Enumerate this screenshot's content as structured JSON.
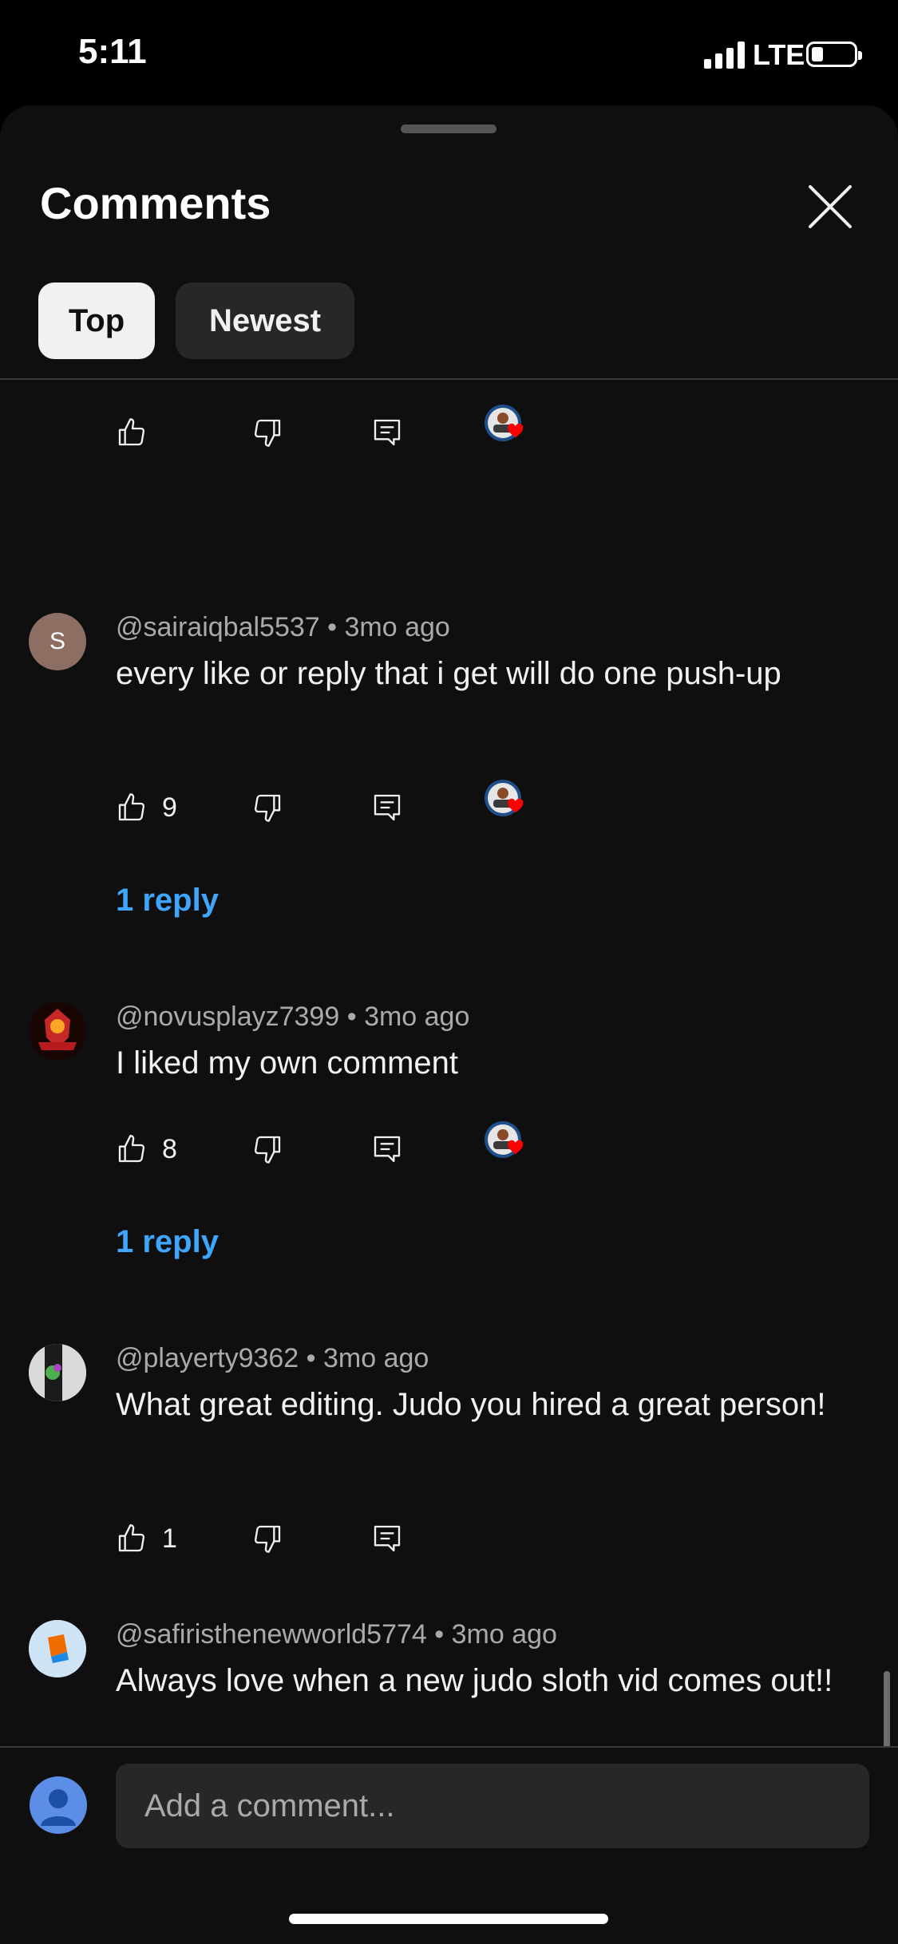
{
  "status_bar": {
    "time": "5:11",
    "network": "LTE"
  },
  "sheet": {
    "title": "Comments",
    "tabs": [
      {
        "label": "Top",
        "active": true
      },
      {
        "label": "Newest",
        "active": false
      }
    ]
  },
  "comments": [
    {
      "author": "@sairaiqbal5537",
      "age": "3mo ago",
      "text": "every like or reply that i get will do one push-up",
      "likes": "9",
      "avatar_letter": "S",
      "creator_heart": true,
      "replies_label": "1 reply"
    },
    {
      "author": "@novusplayz7399",
      "age": "3mo ago",
      "text": "I liked my own comment",
      "likes": "8",
      "creator_heart": true,
      "replies_label": "1 reply"
    },
    {
      "author": "@playerty9362",
      "age": "3mo ago",
      "text": "What great editing. Judo you hired a great person!",
      "likes": "1",
      "creator_heart": false
    },
    {
      "author": "@safiristhenewworld5774",
      "age": "3mo ago",
      "text": "Always love when a new judo sloth vid comes out!!",
      "likes": "",
      "creator_heart": true
    }
  ],
  "composer": {
    "placeholder": "Add a comment..."
  },
  "colors": {
    "background": "#0f0f0f",
    "link": "#3ea6ff",
    "heart": "#ff0000"
  }
}
